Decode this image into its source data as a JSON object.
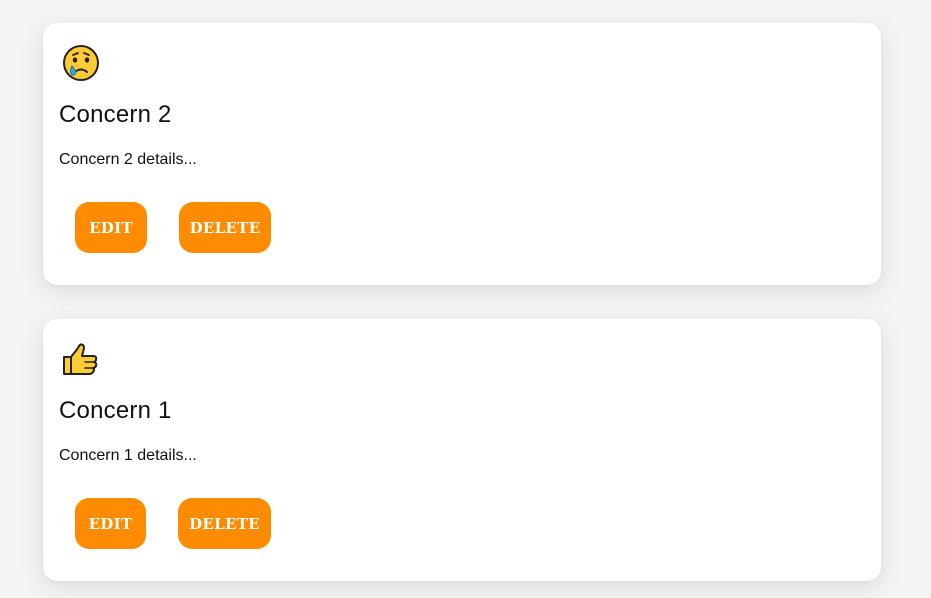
{
  "concerns": [
    {
      "icon": "crying-face-icon",
      "title": "Concern 2",
      "details": "Concern 2 details...",
      "edit_label": "EDIT",
      "delete_label": "DELETE"
    },
    {
      "icon": "thumbs-up-icon",
      "title": "Concern 1",
      "details": "Concern 1 details...",
      "edit_label": "EDIT",
      "delete_label": "DELETE"
    }
  ],
  "colors": {
    "button": "#ff8c00",
    "card": "#ffffff",
    "background": "#f4f4f4"
  }
}
